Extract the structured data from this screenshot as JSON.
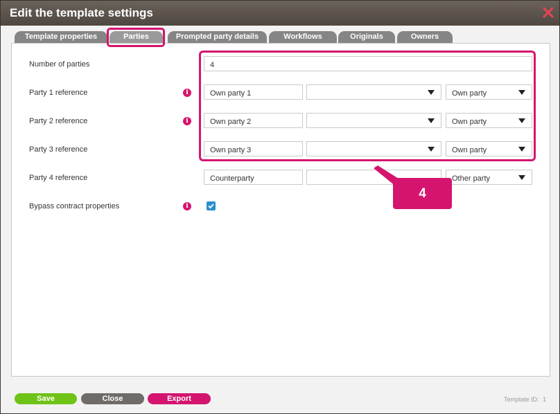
{
  "dialog": {
    "title": "Edit the template settings",
    "close_icon": "close-x-icon",
    "accent_color": "#d4146e"
  },
  "tabs": [
    {
      "label": "Template properties"
    },
    {
      "label": "Parties",
      "active": true
    },
    {
      "label": "Prompted party details"
    },
    {
      "label": "Workflows"
    },
    {
      "label": "Originals"
    },
    {
      "label": "Owners"
    }
  ],
  "form": {
    "number_of_parties": {
      "label": "Number of parties",
      "value": "4"
    },
    "parties": [
      {
        "label": "Party 1 reference",
        "info_icon": "info-icon",
        "name": "Own party 1",
        "role_select": "",
        "type": "Own party"
      },
      {
        "label": "Party 2 reference",
        "info_icon": "info-icon",
        "name": "Own party 2",
        "role_select": "",
        "type": "Own party"
      },
      {
        "label": "Party 3 reference",
        "info_icon": "info-icon",
        "name": "Own party 3",
        "role_select": "",
        "type": "Own party"
      },
      {
        "label": "Party 4 reference",
        "name": "Counterparty",
        "role_select": "",
        "type": "Other party"
      }
    ],
    "bypass": {
      "label": "Bypass contract properties",
      "checked": true
    }
  },
  "callout": {
    "number": "4"
  },
  "footer": {
    "save": "Save",
    "close": "Close",
    "export": "Export",
    "template_id_label": "Template ID:",
    "template_id": "1"
  }
}
